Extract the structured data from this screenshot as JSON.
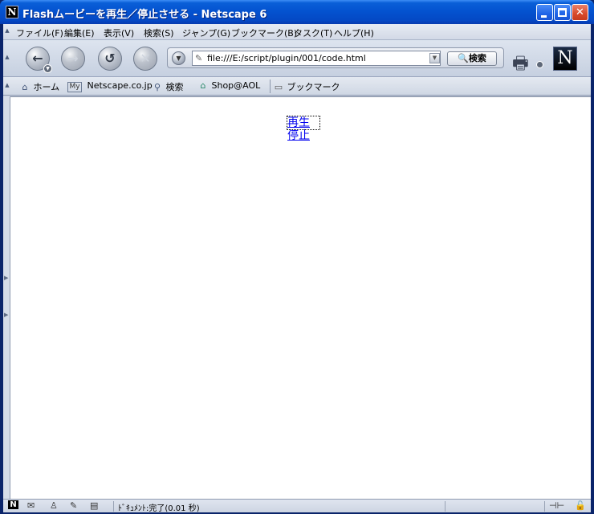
{
  "window": {
    "title": "Flashムービーを再生／停止させる - Netscape 6",
    "app_icon_letter": "N"
  },
  "menu": [
    {
      "label": "ファイル(F)"
    },
    {
      "label": "編集(E)"
    },
    {
      "label": "表示(V)"
    },
    {
      "label": "検索(S)"
    },
    {
      "label": "ジャンプ(G)"
    },
    {
      "label": "ブックマーク(B)"
    },
    {
      "label": "タスク(T)"
    },
    {
      "label": "ヘルプ(H)"
    }
  ],
  "navigation": {
    "url": "file:///E:/script/plugin/001/code.html",
    "search_label": "🔍検索",
    "logo_letter": "N"
  },
  "personal_toolbar": [
    {
      "label": "ホーム",
      "icon": "home-icon"
    },
    {
      "label": "Netscape.co.jp",
      "icon": "my-netscape-icon",
      "icon_text": "My"
    },
    {
      "label": "検索",
      "icon": "search-icon"
    },
    {
      "label": "Shop@AOL",
      "icon": "shop-icon"
    },
    {
      "label": "ブックマーク",
      "icon": "folder-icon"
    }
  ],
  "page": {
    "links": [
      {
        "label": "再生"
      },
      {
        "label": "停止"
      }
    ]
  },
  "status": {
    "text": "ﾄﾞｷｭﾒﾝﾄ:完了(0.01 秒)"
  }
}
